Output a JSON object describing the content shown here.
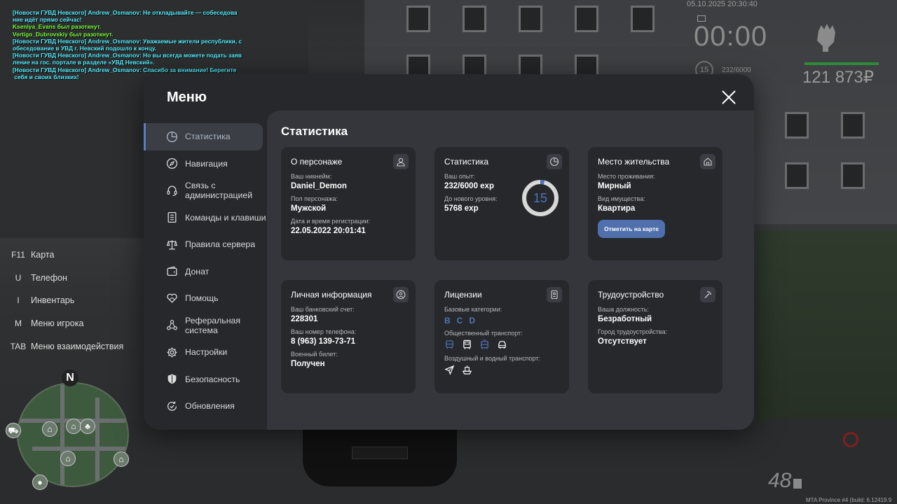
{
  "chat": [
    {
      "cls": "news",
      "text": "[Новости ГУВД Невского] Andrew_Osmanov: Не откладывайте — собеседова"
    },
    {
      "cls": "news",
      "text": "ние идёт прямо сейчас!"
    },
    {
      "cls": "green",
      "text": "Kseniya_Evans был разоткнут."
    },
    {
      "cls": "green",
      "text": "Vertigo_Dubrovskiy был разоткнут."
    },
    {
      "cls": "news",
      "text": "[Новости ГУВД Невского] Andrew_Osmanov: Уважаемые жители республики, с"
    },
    {
      "cls": "news",
      "text": "обеседование в УВД г. Невский подошло к концу."
    },
    {
      "cls": "news",
      "text": "[Новости ГУВД Невского] Andrew_Osmanov: Но вы всегда можете подать заяв"
    },
    {
      "cls": "news",
      "text": "ление на гос. портале в разделе «УВД Невский»."
    },
    {
      "cls": "news",
      "text": "[Новости ГУВД Невского] Andrew_Osmanov: Спасибо за внимание! Берегите"
    },
    {
      "cls": "news",
      "text": " себя и своих близких!"
    }
  ],
  "hud": {
    "date": "05.10.2025 20:30:40",
    "clock": "00:00",
    "level": "15",
    "exp": "232/6000",
    "money": "121 873₽",
    "speed": "48",
    "build": "MTA Province #4 (build: 6.12419.9"
  },
  "keys": [
    {
      "key": "F11",
      "label": "Карта"
    },
    {
      "key": "U",
      "label": "Телефон"
    },
    {
      "key": "I",
      "label": "Инвентарь"
    },
    {
      "key": "M",
      "label": "Меню игрока"
    },
    {
      "key": "TAB",
      "label": "Меню взаимодействия"
    }
  ],
  "minimap": {
    "north": "N"
  },
  "menu": {
    "title": "Меню",
    "sidebar": [
      {
        "label": "Статистика",
        "icon": "pie-chart-icon"
      },
      {
        "label": "Навигация",
        "icon": "compass-icon"
      },
      {
        "label": "Связь с администрацией",
        "icon": "headset-icon"
      },
      {
        "label": "Команды и клавиши",
        "icon": "document-icon"
      },
      {
        "label": "Правила сервера",
        "icon": "scales-icon"
      },
      {
        "label": "Донат",
        "icon": "wallet-icon"
      },
      {
        "label": "Помощь",
        "icon": "heart-hands-icon"
      },
      {
        "label": "Реферальная система",
        "icon": "network-icon"
      },
      {
        "label": "Настройки",
        "icon": "gear-icon"
      },
      {
        "label": "Безопасность",
        "icon": "shield-icon"
      },
      {
        "label": "Обновления",
        "icon": "refresh-icon"
      }
    ],
    "content_title": "Статистика",
    "character": {
      "title": "О персонаже",
      "nick_label": "Ваш никнейм:",
      "nick": "Daniel_Demon",
      "gender_label": "Пол персонажа:",
      "gender": "Мужской",
      "reg_label": "Дата и время регистрации:",
      "reg": "22.05.2022 20:01:41"
    },
    "stats": {
      "title": "Статистика",
      "exp_label": "Ваш опыт:",
      "exp": "232/6000 exp",
      "next_label": "До нового уровня:",
      "next": "5768 exp",
      "level": "15",
      "progress": 0.0387
    },
    "residence": {
      "title": "Место жительства",
      "place_label": "Место проживания:",
      "place": "Мирный",
      "prop_label": "Вид имущества:",
      "prop": "Квартира",
      "map_button": "Отметить на карте"
    },
    "personal": {
      "title": "Личная информация",
      "bank_label": "Ваш банковский счет:",
      "bank": "228301",
      "phone_label": "Ваш номер телефона:",
      "phone": "8 (963) 139-73-71",
      "military_label": "Военный билет:",
      "military": "Получен"
    },
    "licenses": {
      "title": "Лицензии",
      "base_label": "Базовые категории:",
      "categories": [
        "B",
        "C",
        "D"
      ],
      "public_label": "Общественный транспорт:",
      "air_label": "Воздушный и водный транспорт:"
    },
    "job": {
      "title": "Трудоустройство",
      "position_label": "Ваша должность:",
      "position": "Безработный",
      "city_label": "Город трудоустройства:",
      "city": "Отсутствует"
    }
  }
}
